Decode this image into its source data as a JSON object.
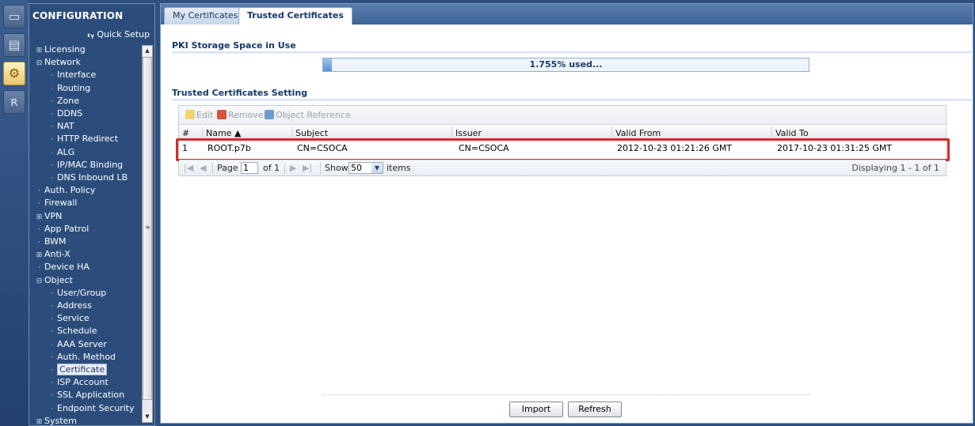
{
  "rail": {
    "icons": [
      "dashboard-icon",
      "monitor-icon",
      "configuration-gear-icon",
      "maintenance-icon"
    ]
  },
  "sidebar": {
    "title": "CONFIGURATION",
    "quick_setup": "Quick Setup",
    "items": [
      {
        "label": "Licensing",
        "marker": "⊞",
        "level": 0
      },
      {
        "label": "Network",
        "marker": "⊟",
        "level": 0
      },
      {
        "label": "Interface",
        "marker": "·",
        "level": 1
      },
      {
        "label": "Routing",
        "marker": "·",
        "level": 1
      },
      {
        "label": "Zone",
        "marker": "·",
        "level": 1
      },
      {
        "label": "DDNS",
        "marker": "·",
        "level": 1
      },
      {
        "label": "NAT",
        "marker": "·",
        "level": 1
      },
      {
        "label": "HTTP Redirect",
        "marker": "·",
        "level": 1
      },
      {
        "label": "ALG",
        "marker": "·",
        "level": 1
      },
      {
        "label": "IP/MAC Binding",
        "marker": "·",
        "level": 1
      },
      {
        "label": "DNS Inbound LB",
        "marker": "·",
        "level": 1
      },
      {
        "label": "Auth. Policy",
        "marker": "·",
        "level": 0
      },
      {
        "label": "Firewall",
        "marker": "·",
        "level": 0
      },
      {
        "label": "VPN",
        "marker": "⊞",
        "level": 0
      },
      {
        "label": "App Patrol",
        "marker": "·",
        "level": 0
      },
      {
        "label": "BWM",
        "marker": "·",
        "level": 0
      },
      {
        "label": "Anti-X",
        "marker": "⊞",
        "level": 0
      },
      {
        "label": "Device HA",
        "marker": "·",
        "level": 0
      },
      {
        "label": "Object",
        "marker": "⊟",
        "level": 0
      },
      {
        "label": "User/Group",
        "marker": "·",
        "level": 1
      },
      {
        "label": "Address",
        "marker": "·",
        "level": 1
      },
      {
        "label": "Service",
        "marker": "·",
        "level": 1
      },
      {
        "label": "Schedule",
        "marker": "·",
        "level": 1
      },
      {
        "label": "AAA Server",
        "marker": "·",
        "level": 1
      },
      {
        "label": "Auth. Method",
        "marker": "·",
        "level": 1
      },
      {
        "label": "Certificate",
        "marker": "·",
        "level": 1,
        "selected": true
      },
      {
        "label": "ISP Account",
        "marker": "·",
        "level": 1
      },
      {
        "label": "SSL Application",
        "marker": "·",
        "level": 1
      },
      {
        "label": "Endpoint Security",
        "marker": "·",
        "level": 1
      },
      {
        "label": "System",
        "marker": "⊞",
        "level": 0
      }
    ]
  },
  "tabs": [
    {
      "label": "My Certificates",
      "active": false
    },
    {
      "label": "Trusted Certificates",
      "active": true
    }
  ],
  "storage": {
    "title": "PKI Storage Space in Use",
    "used_text": "1.755% used...",
    "used_percent": 1.755
  },
  "settings": {
    "title": "Trusted Certificates Setting",
    "toolbar": {
      "edit": "Edit",
      "remove": "Remove",
      "object_reference": "Object Reference"
    },
    "columns": [
      "#",
      "Name ▲",
      "Subject",
      "Issuer",
      "Valid From",
      "Valid To"
    ],
    "rows": [
      {
        "num": "1",
        "name": "ROOT.p7b",
        "subject": "CN=CSOCA",
        "issuer": "CN=CSOCA",
        "valid_from": "2012-10-23 01:21:26 GMT",
        "valid_to": "2017-10-23 01:31:25 GMT"
      }
    ],
    "pager": {
      "page_label": "Page",
      "page_value": "1",
      "of_label": "of 1",
      "show_label": "Show",
      "show_value": "50",
      "items_label": "items",
      "displaying": "Displaying 1 - 1 of 1"
    }
  },
  "buttons": {
    "import": "Import",
    "refresh": "Refresh"
  },
  "colors": {
    "sidebar_bg": "#2c4d7c",
    "accent": "#15396b",
    "highlight_border": "#d42a2a"
  }
}
